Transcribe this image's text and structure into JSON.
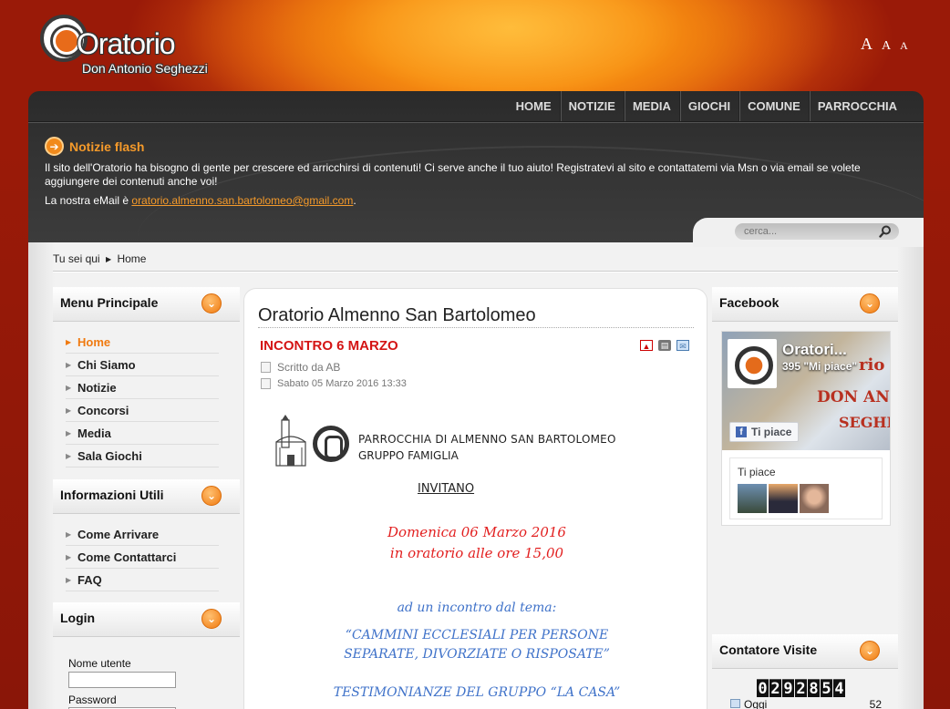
{
  "site": {
    "logo_title": "Oratorio",
    "logo_subtitle": "Don Antonio Seghezzi"
  },
  "font_sizer": [
    "A",
    "A",
    "A"
  ],
  "nav": [
    "HOME",
    "NOTIZIE",
    "MEDIA",
    "GIOCHI",
    "COMUNE",
    "PARROCCHIA"
  ],
  "flash": {
    "title": "Notizie flash",
    "text": "Il sito dell'Oratorio ha bisogno di gente per crescere ed arricchirsi di contenuti! Ci serve anche il tuo aiuto! Registratevi al sito e contattatemi via Msn o via email se volete aggiungere dei contenuti anche voi!",
    "mail_prefix": "La nostra eMail è ",
    "mail": "oratorio.almenno.san.bartolomeo@gmail.com",
    "mail_suffix": "."
  },
  "search": {
    "placeholder": "cerca..."
  },
  "breadcrumb": {
    "prefix": "Tu sei qui",
    "current": "Home"
  },
  "menu_principale": {
    "title": "Menu Principale",
    "items": [
      "Home",
      "Chi Siamo",
      "Notizie",
      "Concorsi",
      "Media",
      "Sala Giochi"
    ]
  },
  "informazioni_utili": {
    "title": "Informazioni Utili",
    "items": [
      "Come Arrivare",
      "Come Contattarci",
      "FAQ"
    ]
  },
  "login": {
    "title": "Login",
    "username_label": "Nome utente",
    "password_label": "Password"
  },
  "article": {
    "page_title": "Oratorio Almenno San Bartolomeo",
    "title": "INCONTRO 6 MARZO",
    "author": "Scritto da AB",
    "date": "Sabato 05 Marzo 2016 13:33",
    "flyer": {
      "line1": "PARROCCHIA DI ALMENNO SAN BARTOLOMEO",
      "line2": "GRUPPO FAMIGLIA",
      "invitano": "INVITANO",
      "date_line1": "Domenica 06 Marzo 2016",
      "date_line2": "in oratorio alle ore 15,00",
      "theme_intro": "ad un incontro dal tema:",
      "theme1": "“CAMMINI ECCLESIALI PER PERSONE",
      "theme2": "SEPARATE, DIVORZIATE O RISPOSATE”",
      "testimonianze": "TESTIMONIANZE DEL GRUPPO “LA CASA”"
    }
  },
  "facebook": {
    "title": "Facebook",
    "page_name": "Oratori...",
    "likes": "395 \"Mi piace\"",
    "like_button": "Ti piace",
    "friends_label": "Ti piace",
    "cover_text": [
      "rio",
      "DON AN",
      "SEGHE"
    ]
  },
  "contatore": {
    "title": "Contatore Visite",
    "digits": [
      "0",
      "2",
      "9",
      "2",
      "8",
      "5",
      "4"
    ],
    "today_label": "Oggi",
    "today_value": "52"
  }
}
